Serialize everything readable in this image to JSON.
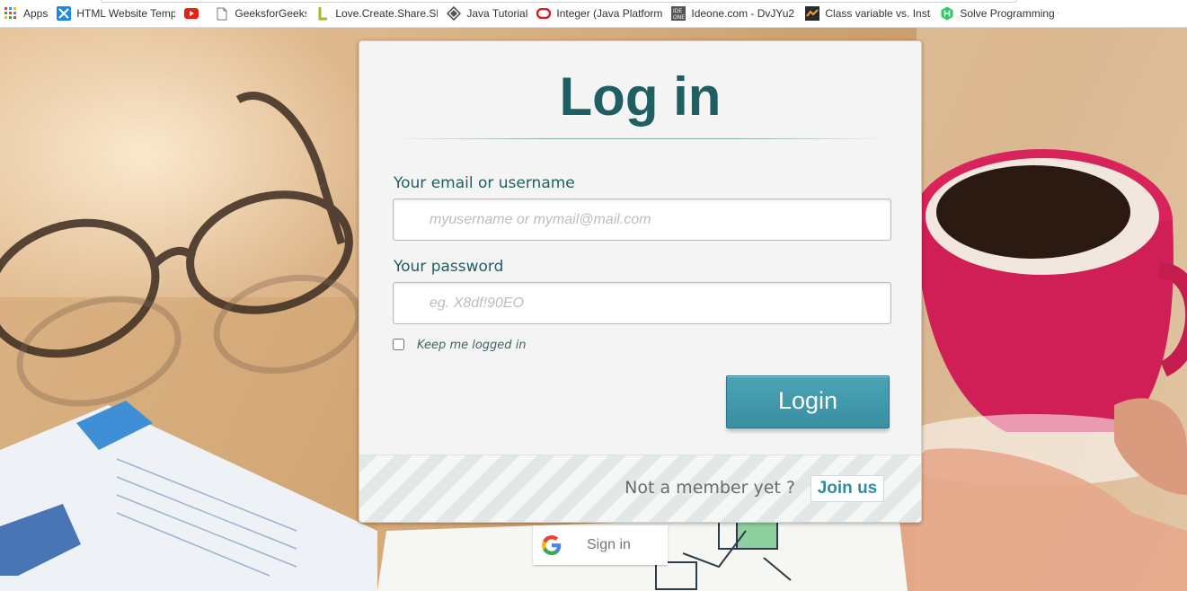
{
  "bookmarks": [
    {
      "icon": "apps-grid-icon",
      "label": "Apps"
    },
    {
      "icon": "html-templates-icon",
      "label": "HTML Website Templa"
    },
    {
      "icon": "youtube-icon",
      "label": ""
    },
    {
      "icon": "document-icon",
      "label": "GeeksforGeeks"
    },
    {
      "icon": "love-create-share-icon",
      "label": "Love.Create.Share.Sho"
    },
    {
      "icon": "java-tutorial-icon",
      "label": "Java Tutorial"
    },
    {
      "icon": "oracle-icon",
      "label": "Integer (Java Platform"
    },
    {
      "icon": "ideone-icon",
      "label": "Ideone.com - DvJYu2"
    },
    {
      "icon": "class-variable-icon",
      "label": "Class variable vs. Insta"
    },
    {
      "icon": "hackerrank-icon",
      "label": "Solve Programming C"
    }
  ],
  "login": {
    "title": "Log in",
    "email_label": "Your email or username",
    "email_placeholder": "myusername or mymail@mail.com",
    "email_value": "",
    "password_label": "Your password",
    "password_placeholder": "eg. X8df!90EO",
    "password_value": "",
    "remember_label": "Keep me logged in",
    "remember_checked": false,
    "login_button": "Login",
    "not_member_text": "Not a member yet ?",
    "join_button": "Join us"
  },
  "google": {
    "signin_label": "Sign in",
    "icon": "google-g-icon"
  },
  "colors": {
    "title": "#1f5e63",
    "login_button": "#3f97aa",
    "join_text": "#2f8f9f",
    "panel": "#f4f4f4"
  }
}
